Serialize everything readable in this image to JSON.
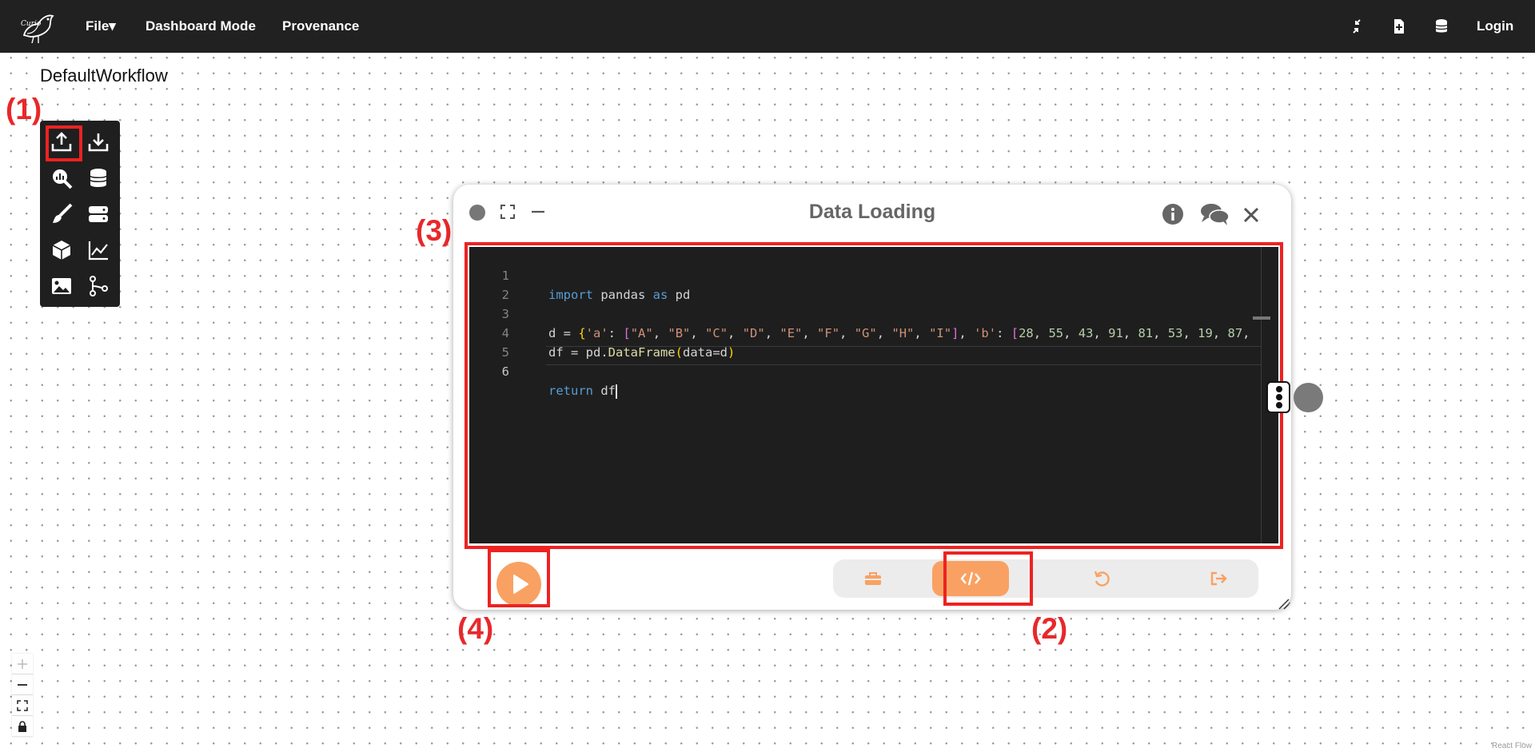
{
  "navbar": {
    "file_label": "File▾",
    "dashboard_label": "Dashboard Mode",
    "provenance_label": "Provenance",
    "login_label": "Login"
  },
  "workflow": {
    "title": "DefaultWorkflow"
  },
  "annotations": [
    "(1)",
    "(2)",
    "(3)",
    "(4)"
  ],
  "toolbox": {
    "icons": [
      "upload-icon",
      "download-icon",
      "search-chart-icon",
      "database-icon",
      "brush-icon",
      "server-icon",
      "cube-icon",
      "line-chart-icon",
      "image-icon",
      "branch-icon"
    ]
  },
  "node": {
    "title": "Data Loading",
    "code_lines": [
      {
        "n": "1",
        "text": "import pandas as pd"
      },
      {
        "n": "2",
        "text": ""
      },
      {
        "n": "3",
        "text": "d = {'a': [\"A\", \"B\", \"C\", \"D\", \"E\", \"F\", \"G\", \"H\", \"I\"], 'b': [28, 55, 43, 91, 81, 53, 19, 87,"
      },
      {
        "n": "4",
        "text": "df = pd.DataFrame(data=d)"
      },
      {
        "n": "5",
        "text": ""
      },
      {
        "n": "6",
        "text": "return df"
      }
    ],
    "tabs": [
      "toolbox-icon",
      "code-icon",
      "undo-icon",
      "exit-icon"
    ],
    "active_tab": "code-icon"
  },
  "colors": {
    "accent": "#f9a163",
    "annotation": "#e8282b",
    "navbar": "#212121",
    "editor_bg": "#1e1e1e"
  },
  "footer": {
    "attribution": "React Flow"
  }
}
